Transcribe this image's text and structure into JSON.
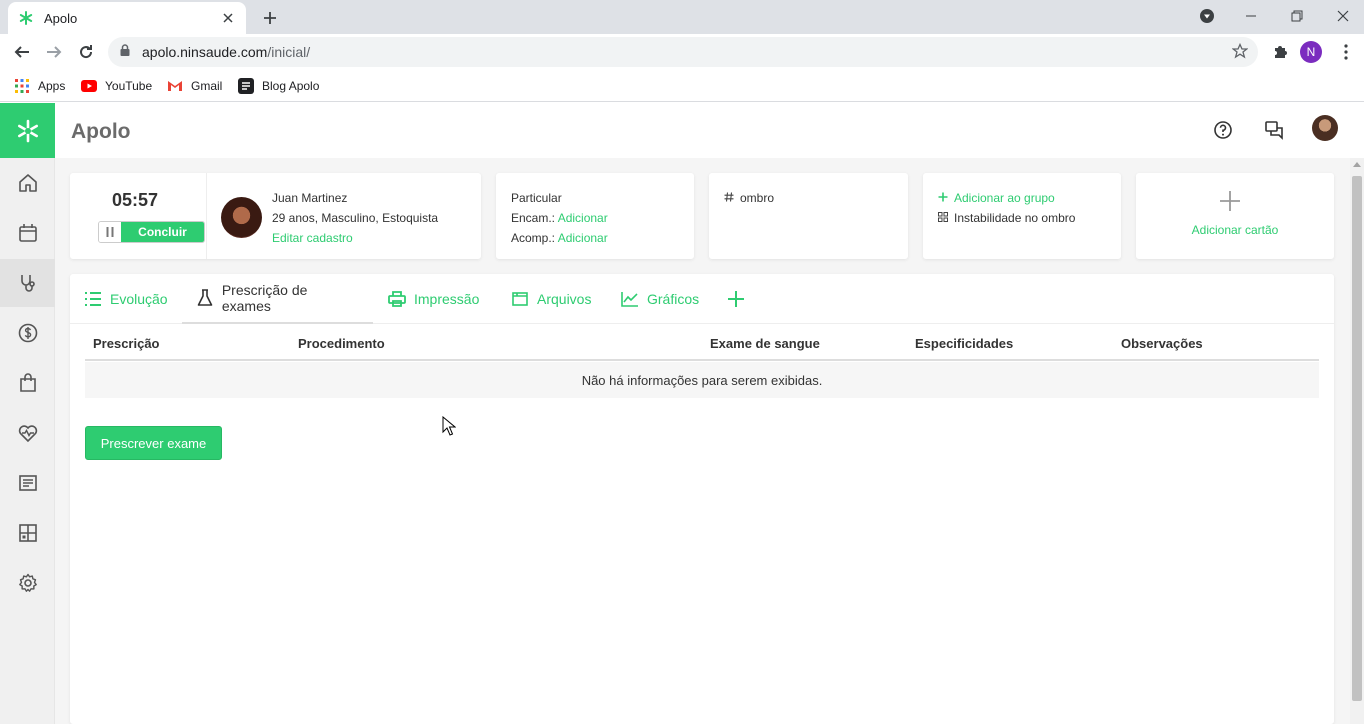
{
  "browser": {
    "tab_title": "Apolo",
    "url_host": "apolo.ninsaude.com",
    "url_path": "/inicial/",
    "profile_initial": "N",
    "bookmarks": [
      "Apps",
      "YouTube",
      "Gmail",
      "Blog Apolo"
    ]
  },
  "app": {
    "brand": "Apolo",
    "timer": "05:57",
    "finish_label": "Concluir",
    "patient": {
      "name": "Juan Martinez",
      "info": "29 anos, Masculino, Estoquista",
      "edit_label": "Editar cadastro"
    },
    "plan": {
      "type": "Particular",
      "encam_label": "Encam.:",
      "acomp_label": "Acomp.:",
      "add_label": "Adicionar"
    },
    "tag": "ombro",
    "group": {
      "add_label": "Adicionar ao grupo",
      "item": "Instabilidade no ombro"
    },
    "add_card_label": "Adicionar cartão",
    "tabs": [
      "Evolução",
      "Prescrição de exames",
      "Impressão",
      "Arquivos",
      "Gráficos"
    ],
    "table": {
      "columns": [
        "Prescrição",
        "Procedimento",
        "Exame de sangue",
        "Especificidades",
        "Observações"
      ],
      "empty_message": "Não há informações para serem exibidas."
    },
    "prescribe_button": "Prescrever exame",
    "colors": {
      "accent": "#2ecc71",
      "brand_text": "#6b6b6b"
    }
  }
}
